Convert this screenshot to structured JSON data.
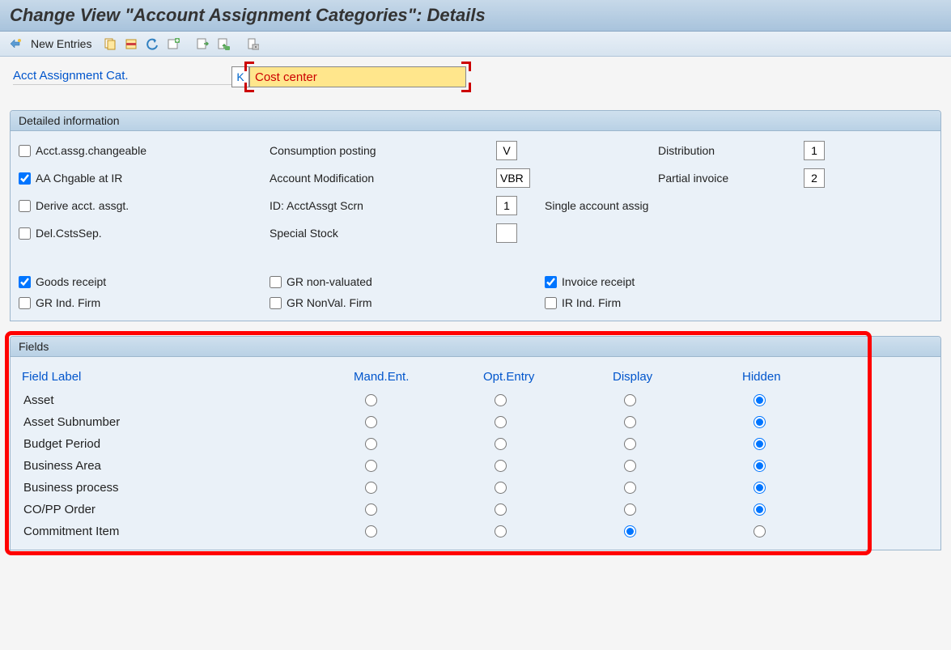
{
  "title": "Change View \"Account Assignment Categories\": Details",
  "toolbar": {
    "new_entries": "New Entries"
  },
  "header": {
    "label": "Acct Assignment Cat.",
    "key": "K",
    "desc": "Cost center"
  },
  "groups": {
    "detailed": "Detailed information",
    "fields": "Fields"
  },
  "detailed": {
    "acct_assg_changeable": {
      "label": "Acct.assg.changeable",
      "checked": false
    },
    "aa_chgable_ir": {
      "label": "AA Chgable at IR",
      "checked": true
    },
    "derive_acct_assgt": {
      "label": "Derive acct. assgt.",
      "checked": false
    },
    "del_csts_sep": {
      "label": "Del.CstsSep.",
      "checked": false
    },
    "consumption_posting": {
      "label": "Consumption posting",
      "value": "V"
    },
    "account_modification": {
      "label": "Account Modification",
      "value": "VBR"
    },
    "id_acctassgt_scrn": {
      "label": "ID: AcctAssgt Scrn",
      "value": "1",
      "hint": "Single account assig"
    },
    "special_stock": {
      "label": "Special Stock",
      "value": ""
    },
    "distribution": {
      "label": "Distribution",
      "value": "1"
    },
    "partial_invoice": {
      "label": "Partial invoice",
      "value": "2"
    },
    "goods_receipt": {
      "label": "Goods receipt",
      "checked": true
    },
    "gr_ind_firm": {
      "label": "GR Ind. Firm",
      "checked": false
    },
    "gr_non_valuated": {
      "label": "GR non-valuated",
      "checked": false
    },
    "gr_nonval_firm": {
      "label": "GR NonVal. Firm",
      "checked": false
    },
    "invoice_receipt": {
      "label": "Invoice receipt",
      "checked": true
    },
    "ir_ind_firm": {
      "label": "IR Ind. Firm",
      "checked": false
    }
  },
  "fields_table": {
    "headers": {
      "field_label": "Field Label",
      "mand_ent": "Mand.Ent.",
      "opt_entry": "Opt.Entry",
      "display": "Display",
      "hidden": "Hidden"
    },
    "rows": [
      {
        "label": "Asset",
        "selected": "hidden"
      },
      {
        "label": "Asset Subnumber",
        "selected": "hidden"
      },
      {
        "label": "Budget Period",
        "selected": "hidden"
      },
      {
        "label": "Business Area",
        "selected": "hidden"
      },
      {
        "label": "Business process",
        "selected": "hidden"
      },
      {
        "label": "CO/PP Order",
        "selected": "hidden"
      },
      {
        "label": "Commitment Item",
        "selected": "display"
      }
    ]
  }
}
